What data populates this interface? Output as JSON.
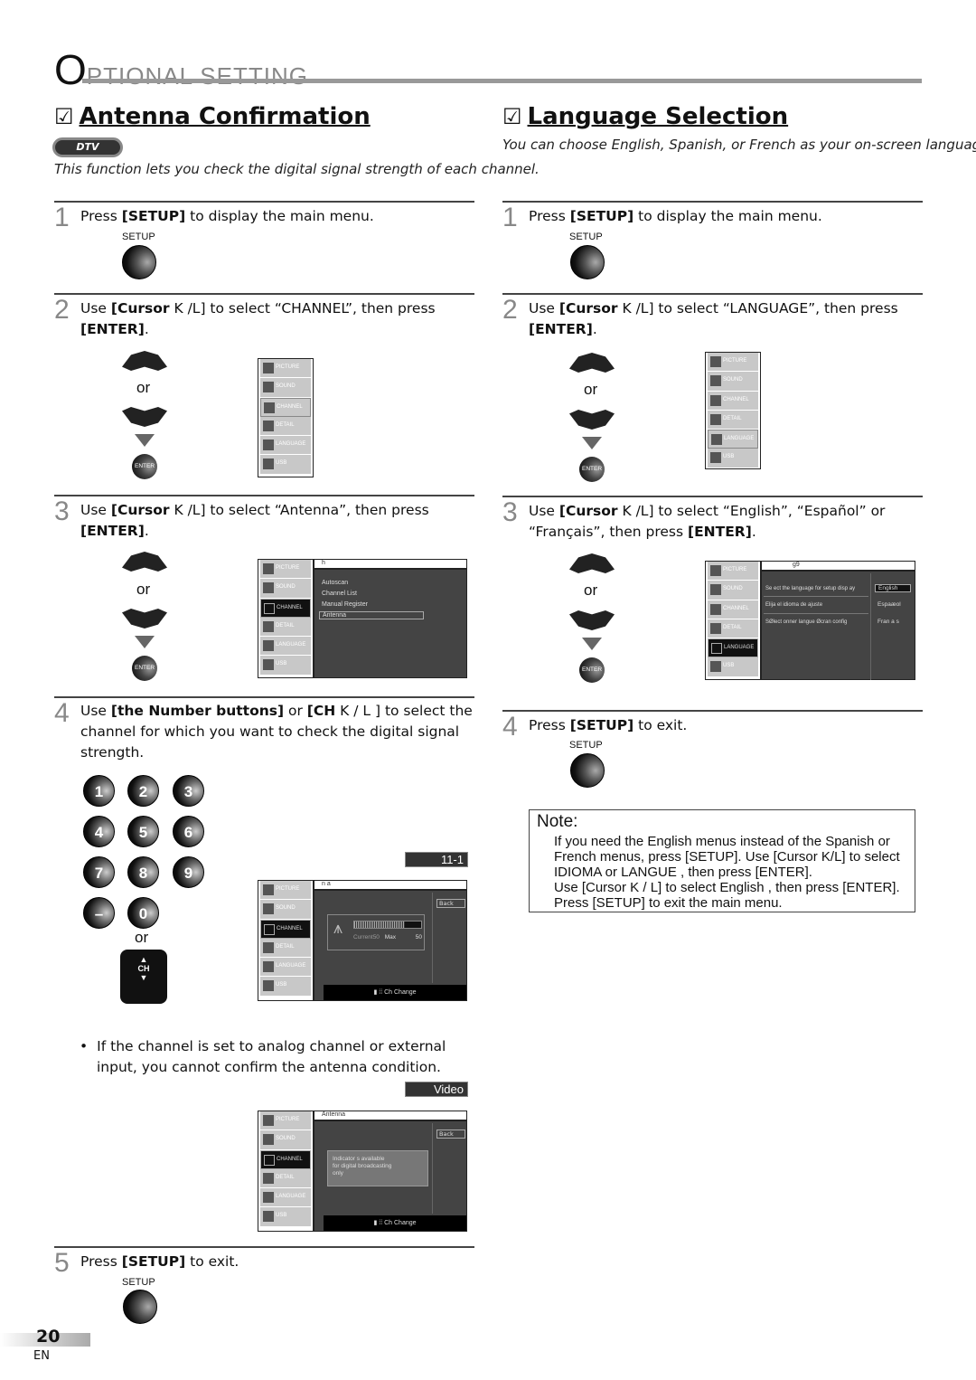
{
  "header": {
    "title_initial": "O",
    "title_rest": "PTIONAL   SETTING"
  },
  "antenna": {
    "title": "Antenna Confirmation",
    "checkbox_glyph": "☑",
    "badge": "DTV",
    "intro": "This function lets you check the digital signal strength of each channel.",
    "steps": [
      {
        "num": "1",
        "text_pre": "Press ",
        "bold": "[SETUP]",
        "text_post": " to display the main menu.",
        "button_label": "SETUP"
      },
      {
        "num": "2",
        "line1_pre": "Use ",
        "line1_bold": "[Cursor",
        "line1_post": " K /L] to select “CHANNEL”, then press",
        "line2_bold": "[ENTER]",
        "line2_post": "."
      },
      {
        "num": "3",
        "line1_pre": "Use ",
        "line1_bold": "[Cursor",
        "line1_post": " K /L] to select “Antenna”, then press",
        "line2_bold": "[ENTER]",
        "line2_post": "."
      },
      {
        "num": "4",
        "line1_pre": "Use ",
        "line1_bold": "[the Number buttons]",
        "line1_mid": " or ",
        "line1_bold2": "[CH",
        "line1_post": " K / L ] to select the",
        "line2": "channel for which you want to check the digital signal",
        "line3": "strength."
      },
      {
        "num": "5",
        "text_pre": "Press ",
        "bold": "[SETUP]",
        "text_post": " to exit.",
        "button_label": "SETUP"
      }
    ],
    "or_label": "or",
    "enter_label": "ENTER",
    "channel_submenu": {
      "head": "h",
      "options": [
        "Autoscan",
        "Channel List",
        "Manual Register",
        "Antenna"
      ],
      "selected": "Antenna"
    },
    "signal_screen": {
      "channel_badge": "11-1",
      "head": "n    a",
      "back": "Back",
      "current_label": "Current",
      "current_value": "50",
      "max_label": "Max",
      "max_value": "50",
      "signal_level_fraction": 0.75,
      "footer": "Ch Change"
    },
    "number_buttons": [
      "1",
      "2",
      "3",
      "4",
      "5",
      "6",
      "7",
      "8",
      "9",
      "–",
      "0"
    ],
    "ch_label": "CH",
    "bullet": {
      "line1": "If the channel is set to analog channel or external",
      "line2": "input, you cannot confirm the antenna condition."
    },
    "analog_screen": {
      "badge": "Video",
      "head": "Antenna",
      "back": "Back",
      "message": [
        "Indicator  s available",
        "for digital broadcasting",
        "only"
      ],
      "footer": "Ch Change"
    }
  },
  "language": {
    "title": "Language Selection",
    "checkbox_glyph": "☑",
    "intro": "You can choose English, Spanish, or French as your on-screen language.",
    "steps": [
      {
        "num": "1",
        "text_pre": "Press ",
        "bold": "[SETUP]",
        "text_post": " to display the main menu.",
        "button_label": "SETUP"
      },
      {
        "num": "2",
        "line1_pre": "Use ",
        "line1_bold": "[Cursor",
        "line1_post": " K /L] to select “LANGUAGE”, then press",
        "line2_bold": "[ENTER]",
        "line2_post": "."
      },
      {
        "num": "3",
        "line1_pre": "Use ",
        "line1_bold": "[Cursor",
        "line1_post": " K /L] to select “English”, “Español” or",
        "line2_pre": "“Français”, then press ",
        "line2_bold": "[ENTER]",
        "line2_post": "."
      },
      {
        "num": "4",
        "text_pre": "Press ",
        "bold": "[SETUP]",
        "text_post": " to exit.",
        "button_label": "SETUP"
      }
    ],
    "or_label": "or",
    "enter_label": "ENTER",
    "lang_submenu": {
      "head": "g9",
      "prompts": [
        "Se ect the language for setup disp ay",
        "Elija el idioma de ajuste",
        "SØlect onner langue Øcran config"
      ],
      "options": [
        "English",
        "Espaæol",
        "Fran a s"
      ],
      "selected": "English"
    },
    "note": {
      "title": "Note:",
      "lines": [
        "If you need the English menus instead of the Spanish or",
        "French menus, press [SETUP]. Use [Cursor K/L] to select",
        " IDIOMA  or  LANGUE , then press [ENTER].",
        "Use [Cursor K / L] to select  English , then press [ENTER].",
        "Press [SETUP] to exit the main menu."
      ]
    }
  },
  "tv_menu": {
    "items": [
      "PICTURE",
      "SOUND",
      "CHANNEL",
      "DETAIL",
      "LANGUAGE",
      "USB"
    ]
  },
  "footer": {
    "page_number": "20",
    "lang": "EN"
  }
}
